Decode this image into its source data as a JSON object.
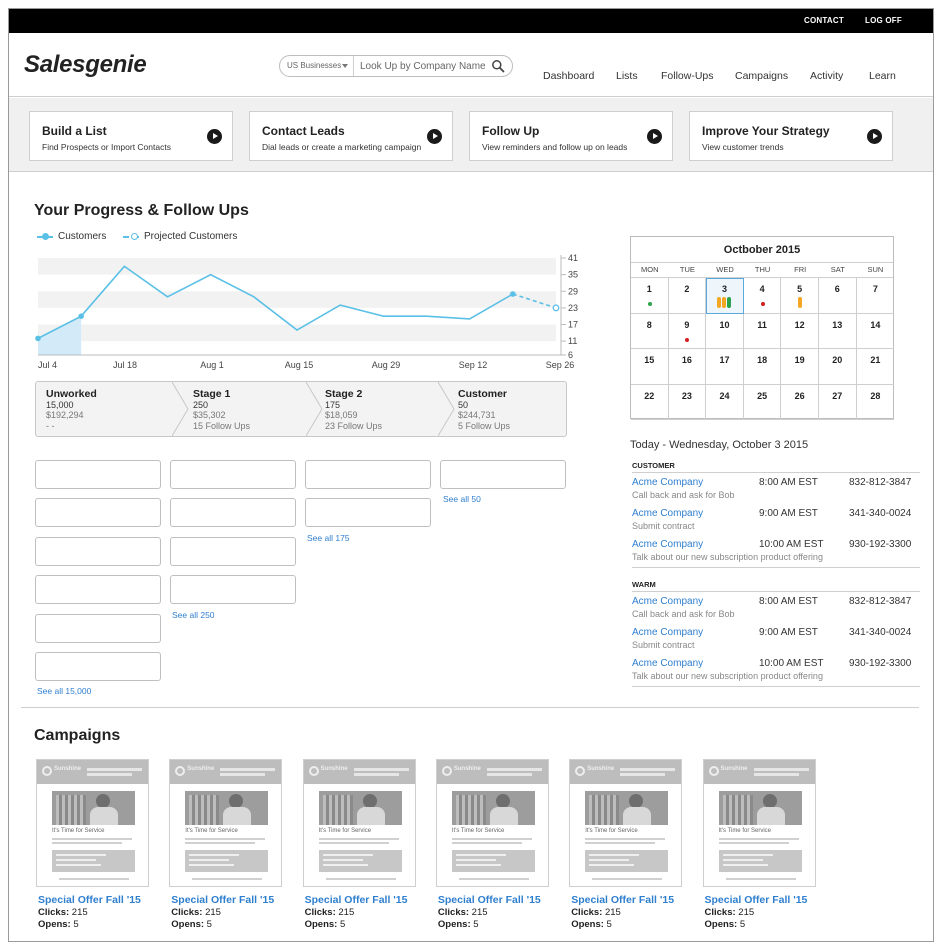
{
  "topbar": {
    "contact": "CONTACT",
    "logoff": "LOG OFF"
  },
  "header": {
    "logo": "Salesgenie",
    "search": {
      "scope": "US Businesses",
      "placeholder": "Look Up by Company Name"
    },
    "nav": [
      "Dashboard",
      "Lists",
      "Follow-Ups",
      "Campaigns",
      "Activity",
      "Learn"
    ]
  },
  "actions": [
    {
      "title": "Build a List",
      "subtitle": "Find Prospects or Import Contacts"
    },
    {
      "title": "Contact Leads",
      "subtitle": "Dial leads or create a marketing campaign"
    },
    {
      "title": "Follow Up",
      "subtitle": "View reminders and follow up on leads"
    },
    {
      "title": "Improve Your Strategy",
      "subtitle": "View customer trends"
    }
  ],
  "progress": {
    "title": "Your Progress & Follow Ups",
    "legend": {
      "customers": "Customers",
      "projected": "Projected Customers"
    }
  },
  "chart_data": {
    "type": "line",
    "x_ticks": [
      "Jul 4",
      "Jul 18",
      "Aug 1",
      "Aug 15",
      "Aug 29",
      "Sep 12",
      "Sep 26"
    ],
    "y_ticks": [
      41,
      35,
      29,
      23,
      17,
      11,
      6
    ],
    "ylim": [
      6,
      41
    ],
    "series": [
      {
        "name": "Customers",
        "values": [
          12,
          20,
          38,
          27,
          35,
          27,
          15,
          24,
          20,
          20,
          19,
          28
        ]
      },
      {
        "name": "Projected Customers",
        "values": [
          28,
          23
        ]
      }
    ],
    "colors": {
      "line": "#5bc0e6",
      "band": "#f2f2f2",
      "fill": "#d3ebf8"
    }
  },
  "stages": [
    {
      "name": "Unworked",
      "count": "15,000",
      "value": "$192,294",
      "followups": "- -"
    },
    {
      "name": "Stage 1",
      "count": "250",
      "value": "$35,302",
      "followups": "15 Follow Ups"
    },
    {
      "name": "Stage 2",
      "count": "175",
      "value": "$18,059",
      "followups": "23 Follow Ups"
    },
    {
      "name": "Customer",
      "count": "50",
      "value": "$244,731",
      "followups": "5 Follow Ups"
    }
  ],
  "see_all": [
    "See all 15,000",
    "See all 250",
    "See all 175",
    "See all 50"
  ],
  "calendar": {
    "title": "Octbober 2015",
    "dow": [
      "MON",
      "TUE",
      "WED",
      "THU",
      "FRI",
      "SAT",
      "SUN"
    ],
    "weeks": [
      [
        "1",
        "2",
        "3",
        "4",
        "5",
        "6",
        "7"
      ],
      [
        "8",
        "9",
        "10",
        "11",
        "12",
        "13",
        "14"
      ],
      [
        "15",
        "16",
        "17",
        "18",
        "19",
        "20",
        "21"
      ],
      [
        "22",
        "23",
        "24",
        "25",
        "26",
        "27",
        "28"
      ]
    ],
    "selected": "3",
    "colors": {
      "green": "#2aa34a",
      "red": "#d21f1f",
      "orange": "#f5a623"
    }
  },
  "today": {
    "title": "Today - Wednesday, October 3 2015",
    "groups": [
      {
        "label": "CUSTOMER",
        "items": [
          {
            "company": "Acme Company",
            "note": "Call back and ask for Bob",
            "time": "8:00 AM EST",
            "phone": "832-812-3847"
          },
          {
            "company": "Acme Company",
            "note": "Submit contract",
            "time": "9:00 AM EST",
            "phone": "341-340-0024"
          },
          {
            "company": "Acme Company",
            "note": "Talk about our new subscription product offering",
            "time": "10:00 AM EST",
            "phone": "930-192-3300"
          }
        ]
      },
      {
        "label": "WARM",
        "items": [
          {
            "company": "Acme Company",
            "note": "Call back and ask for Bob",
            "time": "8:00 AM EST",
            "phone": "832-812-3847"
          },
          {
            "company": "Acme Company",
            "note": "Submit contract",
            "time": "9:00 AM EST",
            "phone": "341-340-0024"
          },
          {
            "company": "Acme Company",
            "note": "Talk about our new subscription product offering",
            "time": "10:00 AM EST",
            "phone": "930-192-3300"
          }
        ]
      }
    ]
  },
  "campaigns": {
    "title": "Campaigns",
    "clicks_label": "Clicks:",
    "opens_label": "Opens:",
    "thumb": {
      "brand": "Sunshine",
      "headline": "It's Time for Service"
    },
    "items": [
      {
        "name": "Special Offer Fall '15",
        "clicks": "215",
        "opens": "5"
      },
      {
        "name": "Special Offer Fall '15",
        "clicks": "215",
        "opens": "5"
      },
      {
        "name": "Special Offer Fall '15",
        "clicks": "215",
        "opens": "5"
      },
      {
        "name": "Special Offer Fall '15",
        "clicks": "215",
        "opens": "5"
      },
      {
        "name": "Special Offer Fall '15",
        "clicks": "215",
        "opens": "5"
      },
      {
        "name": "Special Offer Fall '15",
        "clicks": "215",
        "opens": "5"
      }
    ]
  }
}
